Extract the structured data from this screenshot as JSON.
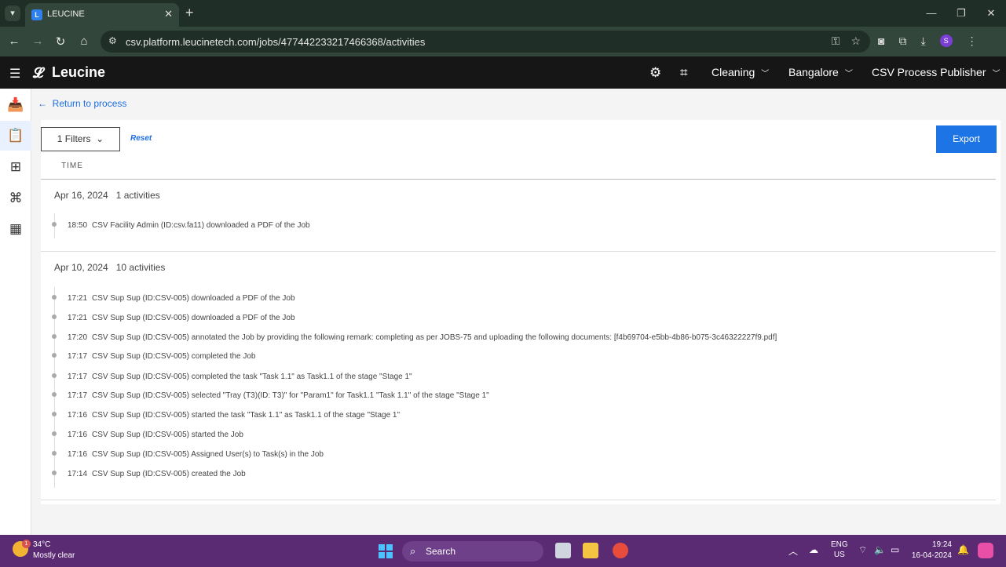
{
  "browser": {
    "tab_title": "LEUCINE",
    "url": "csv.platform.leucinetech.com/jobs/477442233217466368/activities",
    "profile_initial": "S"
  },
  "app": {
    "brand": "Leucine",
    "facility": "Cleaning",
    "site": "Bangalore",
    "role": "CSV Process Publisher"
  },
  "page": {
    "back_label": "Return to process",
    "filters_label": "1 Filters",
    "reset_label": "Reset",
    "export_label": "Export",
    "time_column": "TIME"
  },
  "groups": [
    {
      "date": "Apr 16, 2024",
      "count": "1 activities",
      "activities": [
        {
          "time": "18:50",
          "text": "CSV Facility Admin (ID:csv.fa11) downloaded a PDF of the Job"
        }
      ]
    },
    {
      "date": "Apr 10, 2024",
      "count": "10 activities",
      "activities": [
        {
          "time": "17:21",
          "text": "CSV Sup Sup (ID:CSV-005) downloaded a PDF of the Job"
        },
        {
          "time": "17:21",
          "text": "CSV Sup Sup (ID:CSV-005) downloaded a PDF of the Job"
        },
        {
          "time": "17:20",
          "text": "CSV Sup Sup (ID:CSV-005) annotated the Job by providing the following remark: completing as per JOBS-75 and uploading the following documents: [f4b69704-e5bb-4b86-b075-3c46322227f9.pdf]"
        },
        {
          "time": "17:17",
          "text": "CSV Sup Sup (ID:CSV-005) completed the Job"
        },
        {
          "time": "17:17",
          "text": "CSV Sup Sup (ID:CSV-005) completed the task \"Task 1.1\" as Task1.1 of the stage \"Stage 1\""
        },
        {
          "time": "17:17",
          "text": "CSV Sup Sup (ID:CSV-005) selected \"Tray (T3)(ID: T3)\" for \"Param1\" for Task1.1 \"Task 1.1\" of the stage \"Stage 1\""
        },
        {
          "time": "17:16",
          "text": "CSV Sup Sup (ID:CSV-005) started the task \"Task 1.1\" as Task1.1 of the stage \"Stage 1\""
        },
        {
          "time": "17:16",
          "text": "CSV Sup Sup (ID:CSV-005) started the Job"
        },
        {
          "time": "17:16",
          "text": "CSV Sup Sup (ID:CSV-005) Assigned User(s) to Task(s) in the Job"
        },
        {
          "time": "17:14",
          "text": "CSV Sup Sup (ID:CSV-005) created the Job"
        }
      ]
    }
  ],
  "taskbar": {
    "weather_temp": "34°C",
    "weather_desc": "Mostly clear",
    "weather_badge": "1",
    "search_label": "Search",
    "lang_1": "ENG",
    "lang_2": "US",
    "time": "19:24",
    "date": "16-04-2024"
  }
}
